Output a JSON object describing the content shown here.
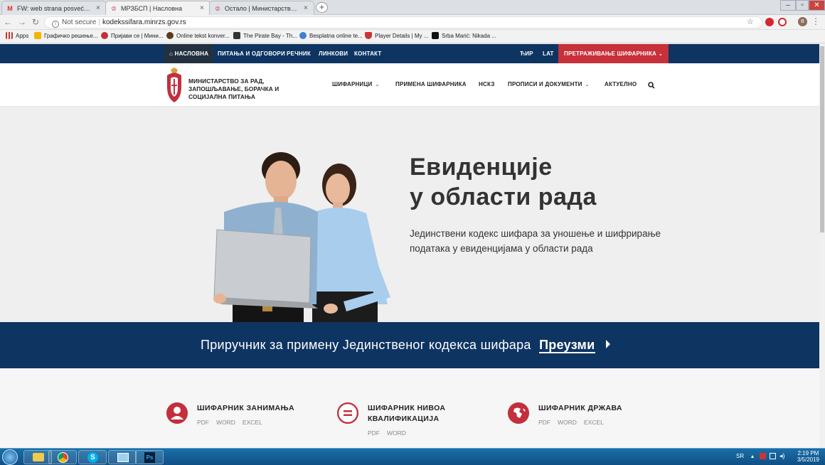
{
  "browser": {
    "tabs": [
      {
        "title": "FW: web strana posvećena šifar...",
        "favicon": "gmail-icon"
      },
      {
        "title": "МРЗБСП | Насловна",
        "favicon": "crest-icon"
      },
      {
        "title": "Остало | Министарство за рад,...",
        "favicon": "crest-icon"
      }
    ],
    "security": "Not secure",
    "url": "kodekssifara.minrzs.gov.rs",
    "bookmarks": [
      {
        "label": "Apps",
        "icon": "apps-grid-icon"
      },
      {
        "label": "Графичко решење...",
        "icon": "folder-icon"
      },
      {
        "label": "Пријави се | Мини...",
        "icon": "crest-icon"
      },
      {
        "label": "Online tekst konver...",
        "icon": "globe-icon"
      },
      {
        "label": "The Pirate Bay - Th...",
        "icon": "ship-icon"
      },
      {
        "label": "Besplatna online te...",
        "icon": "globe-icon"
      },
      {
        "label": "Player Details | My ...",
        "icon": "shield-icon"
      },
      {
        "label": "Srba Marić: Nikada ...",
        "icon": "blog-icon"
      }
    ],
    "profile_initial": "B"
  },
  "site": {
    "topnav": {
      "items": [
        "НАСЛОВНА",
        "ПИТАЊА И ОДГОВОРИ",
        "РЕЧНИК",
        "ЛИНКОВИ",
        "КОНТАКТ"
      ],
      "script_cyr": "ЋИР",
      "script_lat": "LAT",
      "search_label": "ПРЕТРАЖИВАЊЕ ШИФАРНИКА"
    },
    "ministry": "МИНИСТАРСТВО ЗА РАД, ЗАПОШЉАВАЊЕ, БОРАЧКА И СОЦИЈАЛНА ПИТАЊА",
    "mainnav": [
      "ШИФАРНИЦИ",
      "ПРИМЕНА ШИФАРНИКА",
      "НСКЗ",
      "ПРОПИСИ И ДОКУМЕНТИ",
      "АКТУЕЛНО"
    ],
    "hero": {
      "title_line1": "Евиденције",
      "title_line2": "у области рада",
      "text": "Јединствени кодекс шифара за уношење и шифрирање података у евиденцијама у области рада"
    },
    "banner": {
      "text": "Приручник за примену Јединственог кодекса шифара",
      "link": "Преузми"
    },
    "codebooks": [
      {
        "title": "ШИФАРНИК ЗАНИМАЊА",
        "links": [
          "PDF",
          "WORD",
          "EXCEL"
        ],
        "icon": "person-icon"
      },
      {
        "title": "ШИФАРНИК НИВОА КВАЛИФИКАЦИЈА",
        "links": [
          "PDF",
          "WORD"
        ],
        "icon": "equals-icon"
      },
      {
        "title": "ШИФАРНИК ДРЖАВА",
        "links": [
          "PDF",
          "WORD",
          "EXCEL"
        ],
        "icon": "globe-icon"
      }
    ]
  },
  "taskbar": {
    "language": "SR",
    "time": "2:19 PM",
    "date": "3/5/2019"
  },
  "colors": {
    "navy": "#0e3462",
    "red": "#c8303a"
  }
}
